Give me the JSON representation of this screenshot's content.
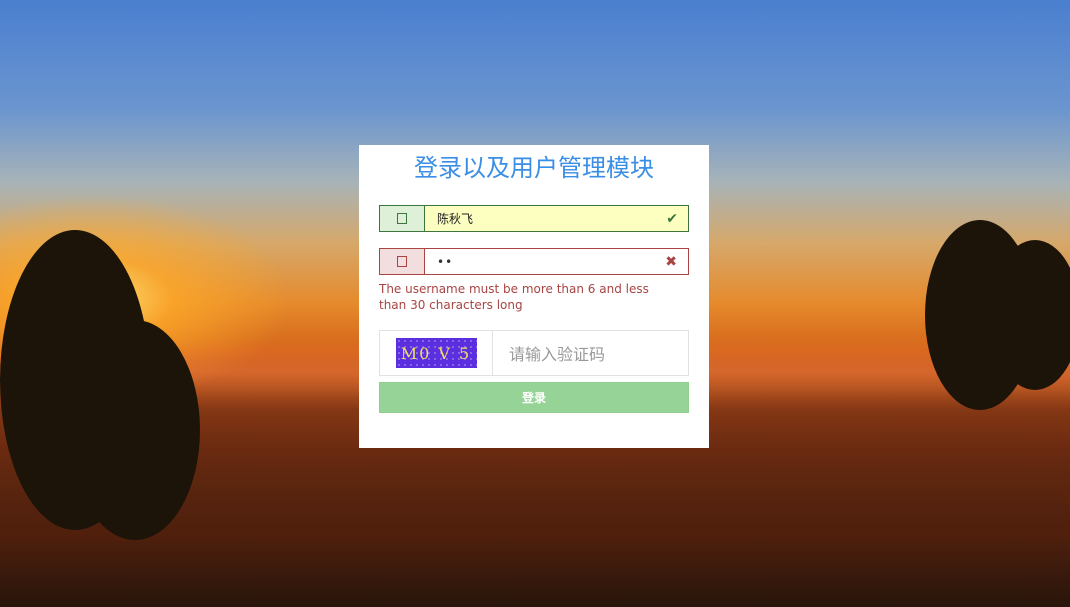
{
  "page": {
    "title": "登录以及用户管理模块"
  },
  "username": {
    "icon": "user-icon",
    "value": "陈秋飞",
    "status": "valid",
    "status_icon": "✔"
  },
  "password": {
    "icon": "lock-icon",
    "value": "••",
    "status": "invalid",
    "status_icon": "✖",
    "error_message": "The username must be more than 6 and less than 30 characters long"
  },
  "captcha": {
    "code_text": "M0 V 5",
    "placeholder": "请输入验证码"
  },
  "login_button": {
    "label": "登录"
  },
  "colors": {
    "title": "#3a8ee6",
    "success": "#3c763d",
    "error": "#a94442",
    "button": "#95d496",
    "captcha_bg": "#5b2fe0"
  }
}
